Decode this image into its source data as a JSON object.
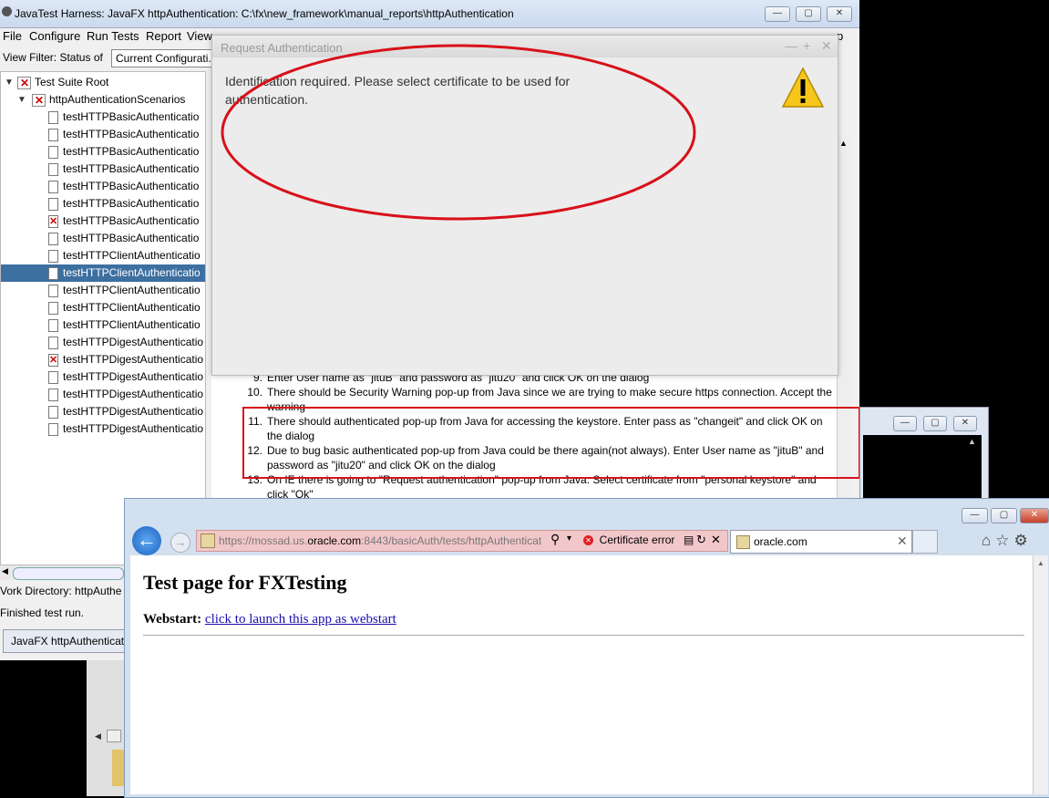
{
  "jt": {
    "title": "JavaTest Harness: JavaFX httpAuthentication: C:\\fx\\new_framework\\manual_reports\\httpAuthentication",
    "menu": [
      "File",
      "Configure",
      "Run Tests",
      "Report",
      "View"
    ],
    "help_fragment": "p",
    "filter_label": "View Filter: Status of",
    "filter_value": "Current Configurati...",
    "tree_root": "Test Suite Root",
    "tree_group": "httpAuthenticationScenarios",
    "tree_items": [
      "testHTTPBasicAuthenticatio",
      "testHTTPBasicAuthenticatio",
      "testHTTPBasicAuthenticatio",
      "testHTTPBasicAuthenticatio",
      "testHTTPBasicAuthenticatio",
      "testHTTPBasicAuthenticatio",
      "testHTTPBasicAuthenticatio",
      "testHTTPBasicAuthenticatio",
      "testHTTPClientAuthenticatio",
      "testHTTPClientAuthenticatio",
      "testHTTPClientAuthenticatio",
      "testHTTPClientAuthenticatio",
      "testHTTPClientAuthenticatio",
      "testHTTPDigestAuthenticatio",
      "testHTTPDigestAuthenticatio",
      "testHTTPDigestAuthenticatio",
      "testHTTPDigestAuthenticatio",
      "testHTTPDigestAuthenticatio",
      "testHTTPDigestAuthenticatio"
    ],
    "work_dir": "Vork Directory:  httpAuthe",
    "status": "Finished test run.",
    "task_button": "JavaFX httpAuthenticati"
  },
  "instructions": [
    {
      "num": "9.",
      "text": "Enter User name as \"jituB\" and password as \"jitu20\" and click OK on the dialog"
    },
    {
      "num": "10.",
      "text": "There should be Security Warning pop-up from Java since we are trying to make secure https connection. Accept the warning"
    },
    {
      "num": "11.",
      "text": "There should authenticated pop-up from Java for accessing the keystore. Enter pass as \"changeit\" and click OK on the dialog"
    },
    {
      "num": "12.",
      "text": "Due to bug basic authenticated pop-up from Java could be there again(not always). Enter User name as \"jituB\" and password as \"jitu20\" and click OK on the dialog"
    },
    {
      "num": "13.",
      "text": "On IE there is going to \"Request authentication\" pop-up from Java. Select certificate from \"personal keystore\" and click \"Ok\""
    }
  ],
  "dialog": {
    "title": "Request Authentication",
    "message": "Identification required. Please select certificate to be used for authentication.",
    "icon": "warning-icon"
  },
  "ie": {
    "url_prefix": "https://mossad.us.",
    "url_domain": "oracle.com",
    "url_suffix": ":8443/basicAuth/tests/httpAuthenticat",
    "cert_error": "Certificate error",
    "tab_label": "oracle.com",
    "page_title": "Test page for FXTesting",
    "webstart_label": "Webstart:",
    "webstart_link": "click to launch this app as webstart"
  },
  "colors": {
    "annotation_red": "#d8101a",
    "tree_selection": "#3d6fa0",
    "addr_error_bg": "#f2c7c9"
  }
}
